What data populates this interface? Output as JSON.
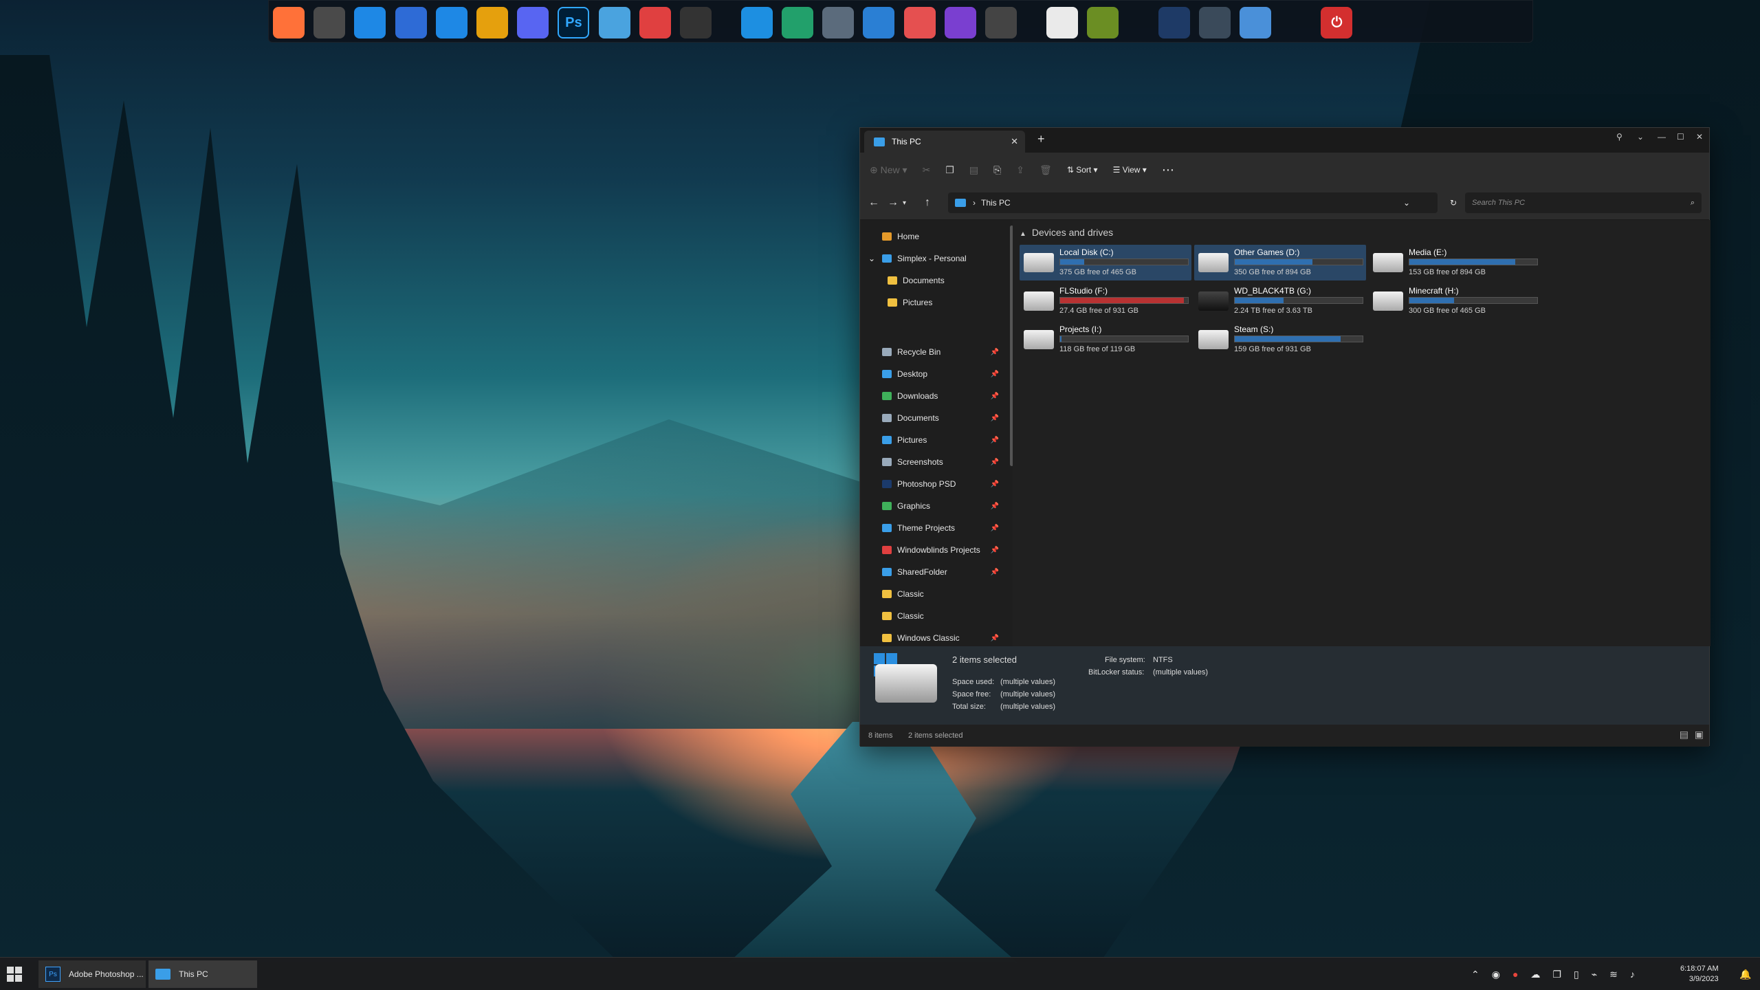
{
  "dock": {
    "apps": [
      "firefox-icon",
      "sublime-icon",
      "headphones-icon",
      "photos-icon",
      "mail-icon",
      "plex-icon",
      "discord-icon",
      "photoshop-icon",
      "monitor-icon",
      "gamebar-icon",
      "controller-icon",
      "folder-icon",
      "downloads-icon",
      "documents-icon",
      "pictures-icon",
      "music-icon",
      "videos-icon",
      "camera-icon",
      "drive-icon",
      "minecraft-icon",
      "media-player-icon",
      "settings-icon",
      "recycle-bin-icon",
      "power-icon"
    ],
    "ps_label": "Ps"
  },
  "window": {
    "tab_title": "This PC",
    "close": "✕",
    "new_tab": "+",
    "controls": [
      "⚲",
      "⌄",
      "—",
      "☐",
      "✕"
    ]
  },
  "toolbar": {
    "new": "New",
    "sort": "Sort",
    "view": "View",
    "more": "⋯"
  },
  "address": {
    "path": "This PC",
    "search_placeholder": "Search This PC"
  },
  "sidebar": {
    "items": [
      {
        "label": "Home",
        "pin": false,
        "indent": 0,
        "color": "#e59a2a"
      },
      {
        "label": "Simplex - Personal",
        "pin": false,
        "indent": 0,
        "color": "#3a9ee8"
      },
      {
        "label": "Documents",
        "pin": false,
        "indent": 1,
        "color": "#f0c040"
      },
      {
        "label": "Pictures",
        "pin": false,
        "indent": 1,
        "color": "#f0c040"
      },
      {
        "label": "Recycle Bin",
        "pin": true,
        "indent": 0,
        "color": "#9ab"
      },
      {
        "label": "Desktop",
        "pin": true,
        "indent": 0,
        "color": "#3a9ee8"
      },
      {
        "label": "Downloads",
        "pin": true,
        "indent": 0,
        "color": "#3fb05a"
      },
      {
        "label": "Documents",
        "pin": true,
        "indent": 0,
        "color": "#9ab"
      },
      {
        "label": "Pictures",
        "pin": true,
        "indent": 0,
        "color": "#3a9ee8"
      },
      {
        "label": "Screenshots",
        "pin": true,
        "indent": 0,
        "color": "#9ab"
      },
      {
        "label": "Photoshop PSD",
        "pin": true,
        "indent": 0,
        "color": "#1b3a6b"
      },
      {
        "label": "Graphics",
        "pin": true,
        "indent": 0,
        "color": "#3fb05a"
      },
      {
        "label": "Theme Projects",
        "pin": true,
        "indent": 0,
        "color": "#3a9ee8"
      },
      {
        "label": "Windowblinds Projects",
        "pin": true,
        "indent": 0,
        "color": "#e04040"
      },
      {
        "label": "SharedFolder",
        "pin": true,
        "indent": 0,
        "color": "#3a9ee8"
      },
      {
        "label": "Classic",
        "pin": false,
        "indent": 0,
        "color": "#f0c040"
      },
      {
        "label": "Classic",
        "pin": false,
        "indent": 0,
        "color": "#f0c040"
      },
      {
        "label": "Windows Classic",
        "pin": true,
        "indent": 0,
        "color": "#f0c040"
      }
    ]
  },
  "main": {
    "group": "Devices and drives",
    "drives": [
      {
        "name": "Local Disk (C:)",
        "free": "375 GB free of 465 GB",
        "used": 0.19,
        "selected": true,
        "dark": false,
        "critical": false
      },
      {
        "name": "Other Games (D:)",
        "free": "350 GB free of 894 GB",
        "used": 0.61,
        "selected": true,
        "dark": false,
        "critical": false
      },
      {
        "name": "Media (E:)",
        "free": "153 GB free of 894 GB",
        "used": 0.83,
        "selected": false,
        "dark": false,
        "critical": false
      },
      {
        "name": "FLStudio (F:)",
        "free": "27.4 GB free of 931 GB",
        "used": 0.97,
        "selected": false,
        "dark": false,
        "critical": true
      },
      {
        "name": "WD_BLACK4TB (G:)",
        "free": "2.24 TB free of 3.63 TB",
        "used": 0.38,
        "selected": false,
        "dark": true,
        "critical": false
      },
      {
        "name": "Minecraft (H:)",
        "free": "300 GB free of 465 GB",
        "used": 0.35,
        "selected": false,
        "dark": false,
        "critical": false
      },
      {
        "name": "Projects (I:)",
        "free": "118 GB free of 119 GB",
        "used": 0.01,
        "selected": false,
        "dark": false,
        "critical": false
      },
      {
        "name": "Steam (S:)",
        "free": "159 GB free of 931 GB",
        "used": 0.83,
        "selected": false,
        "dark": false,
        "critical": false
      }
    ]
  },
  "details": {
    "title": "2 items selected",
    "space_used_label": "Space used:",
    "space_used": "(multiple values)",
    "space_free_label": "Space free:",
    "space_free": "(multiple values)",
    "total_label": "Total size:",
    "total": "(multiple values)",
    "fs_label": "File system:",
    "fs": "NTFS",
    "bitlocker_label": "BitLocker status:",
    "bitlocker": "(multiple values)"
  },
  "status": {
    "count": "8 items",
    "selected": "2 items selected"
  },
  "taskbar": {
    "photoshop": "Adobe Photoshop ...",
    "thispc": "This PC",
    "time": "6:18:07 AM",
    "date": "3/9/2023"
  }
}
